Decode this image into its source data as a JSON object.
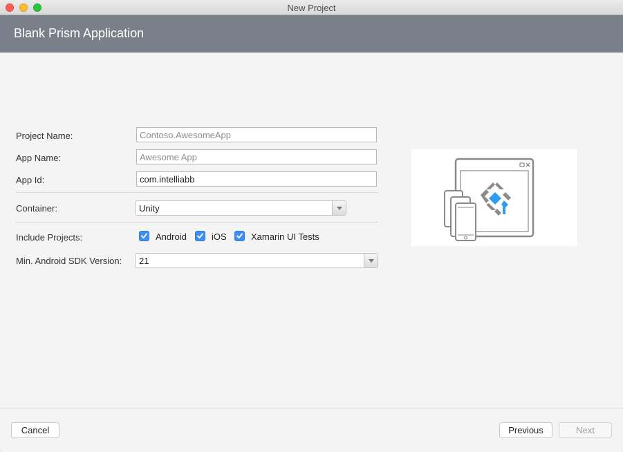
{
  "window": {
    "title": "New Project"
  },
  "header": {
    "title": "Blank Prism Application"
  },
  "form": {
    "project_name": {
      "label": "Project Name:",
      "value": "",
      "placeholder": "Contoso.AwesomeApp"
    },
    "app_name": {
      "label": "App Name:",
      "value": "",
      "placeholder": "Awesome App"
    },
    "app_id": {
      "label": "App Id:",
      "value": "com.intelliabb",
      "placeholder": ""
    },
    "container": {
      "label": "Container:",
      "selected": "Unity"
    },
    "include_projects": {
      "label": "Include Projects:",
      "options": [
        {
          "label": "Android",
          "checked": true
        },
        {
          "label": "iOS",
          "checked": true
        },
        {
          "label": "Xamarin UI Tests",
          "checked": true
        }
      ]
    },
    "min_sdk": {
      "label": "Min. Android SDK Version:",
      "selected": "21"
    }
  },
  "footer": {
    "cancel": "Cancel",
    "previous": "Previous",
    "next": "Next",
    "next_enabled": false
  },
  "colors": {
    "banner": "#79808a",
    "checkbox": "#3f8ef5",
    "logo_accent": "#2e9bf0"
  },
  "icons": {
    "preview": "prism-devices-illustration"
  }
}
